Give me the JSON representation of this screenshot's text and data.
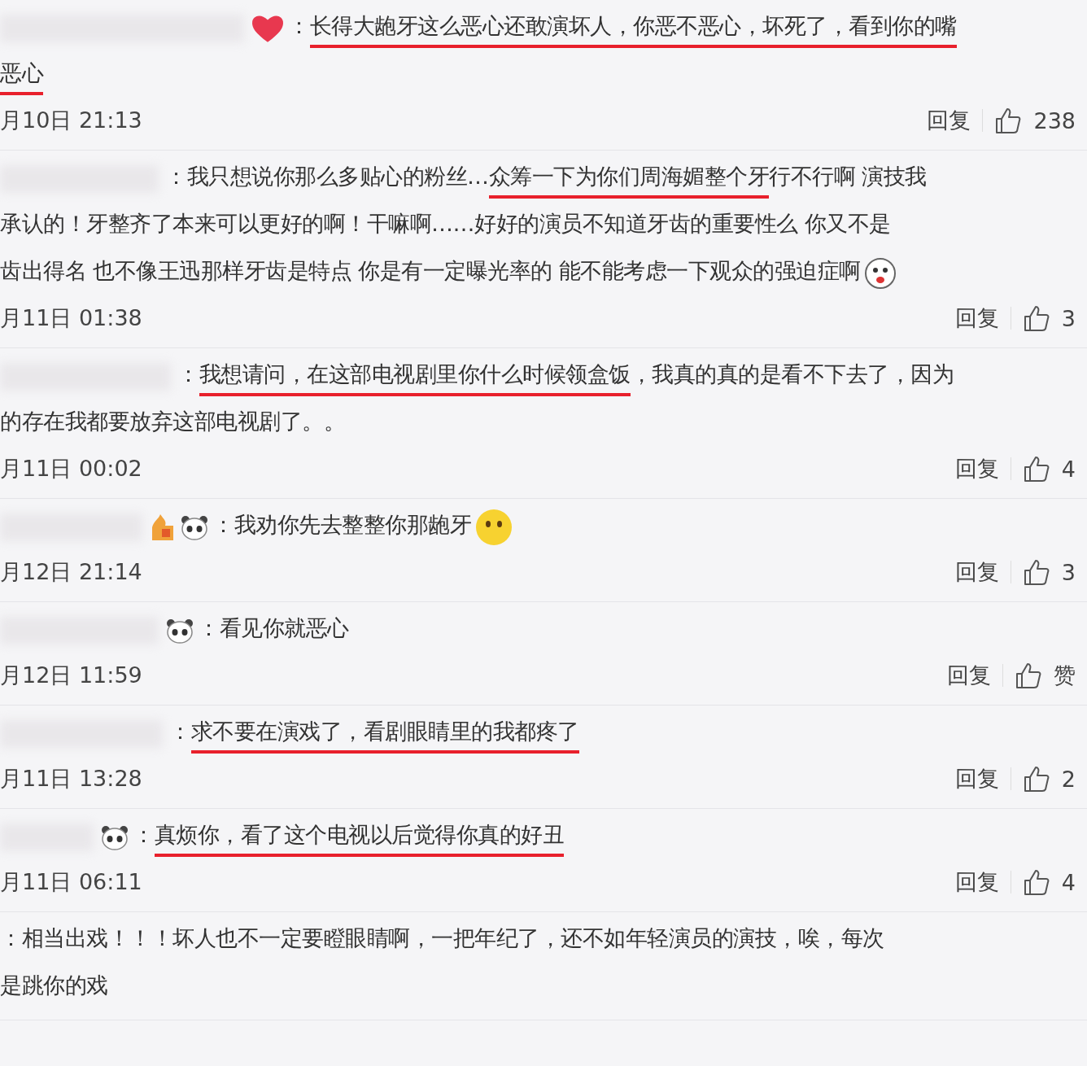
{
  "comments": [
    {
      "badges": [
        {
          "kind": "heart"
        }
      ],
      "lines": [
        [
          {
            "text": "：",
            "underlined": false
          },
          {
            "text": "长得大龅牙这么恶心还敢演坏人，你恶不恶心，坏死了，看到你的嘴",
            "underlined": true
          }
        ],
        [
          {
            "text": "恶心",
            "underlined": true
          }
        ]
      ],
      "date": "月10日 21:13",
      "reply": "回复",
      "likes": "238"
    },
    {
      "lines": [
        [
          {
            "text": "：我只想说你那么多贴心的粉丝…",
            "underlined": false
          },
          {
            "text": "众筹一下为你们周海媚整个牙",
            "underlined": true
          },
          {
            "text": " 行不行啊 演技我",
            "underlined": false
          }
        ],
        [
          {
            "text": "承认的！牙整齐了本来可以更好的啊！干嘛啊……好好的演员不知道牙齿的重要性么 你又不是",
            "underlined": false
          }
        ],
        [
          {
            "text": "齿出得名 也不像王迅那样牙齿是特点 你是有一定曝光率的 能不能考虑一下观众的强迫症啊",
            "underlined": false
          }
        ]
      ],
      "trailing_emoji": {
        "kind": "face"
      },
      "date": "月11日 01:38",
      "reply": "回复",
      "likes": "3"
    },
    {
      "lines": [
        [
          {
            "text": "：",
            "underlined": false
          },
          {
            "text": "我想请问，在这部电视剧里你什么时候领盒饭",
            "underlined": true
          },
          {
            "text": "，我真的真的是看不下去了，因为",
            "underlined": false
          }
        ],
        [
          {
            "text": "的存在我都要放弃这部电视剧了。。",
            "underlined": false
          }
        ]
      ],
      "date": "月11日 00:02",
      "reply": "回复",
      "likes": "4"
    },
    {
      "badges": [
        {
          "kind": "fire"
        },
        {
          "kind": "panda"
        }
      ],
      "lines": [
        [
          {
            "text": "：我劝你先去整整你那龅牙",
            "underlined": false
          }
        ]
      ],
      "trailing_emoji": {
        "kind": "smiley"
      },
      "date": "月12日 21:14",
      "reply": "回复",
      "likes": "3"
    },
    {
      "badges": [
        {
          "kind": "panda"
        }
      ],
      "lines": [
        [
          {
            "text": "：看见你就恶心",
            "underlined": false
          }
        ]
      ],
      "date": "月12日 11:59",
      "reply": "回复",
      "likes": "赞"
    },
    {
      "lines": [
        [
          {
            "text": "：",
            "underlined": false
          },
          {
            "text": "求不要在演戏了，看剧眼睛里的我都疼了",
            "underlined": true
          }
        ]
      ],
      "date": "月11日 13:28",
      "reply": "回复",
      "likes": "2"
    },
    {
      "badges": [
        {
          "kind": "panda"
        }
      ],
      "lines": [
        [
          {
            "text": "：",
            "underlined": false
          },
          {
            "text": "真烦你，看了这个电视以后觉得你真的好丑",
            "underlined": true
          }
        ]
      ],
      "date": "月11日 06:11",
      "reply": "回复",
      "likes": "4"
    },
    {
      "lines": [
        [
          {
            "text": "：相当出戏！！！坏人也不一定要瞪眼睛啊，一把年纪了，还不如年轻演员的演技，唉，每次",
            "underlined": false
          }
        ],
        [
          {
            "text": "是跳你的戏",
            "underlined": false
          }
        ]
      ]
    }
  ]
}
